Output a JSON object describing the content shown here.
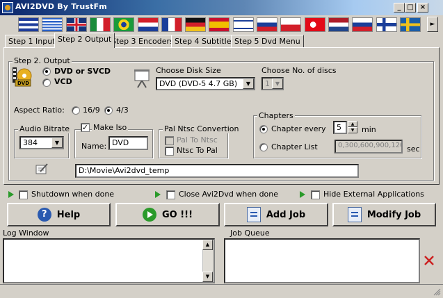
{
  "window": {
    "title": "AVI2DVD By TrustFm",
    "minimize_label": "_",
    "maximize_label": "□",
    "close_label": "×"
  },
  "flags": [
    "cuba",
    "greece",
    "uk",
    "italy",
    "brazil",
    "croatia",
    "france",
    "germany",
    "spain",
    "israel",
    "russia",
    "poland",
    "turkey",
    "netherlands",
    "slovakia",
    "finland",
    "sweden"
  ],
  "flag_scroll_label": "►",
  "tabs": [
    "Step 1 Input",
    "Step 2 Output",
    "Step 3 Encoders",
    "Step 4 Subtitles",
    "Step 5 Dvd Menu"
  ],
  "active_tab": "Step 2 Output",
  "output": {
    "group_label": "Step 2. Output",
    "dvd_label": "DVD or SVCD",
    "vcd_label": "VCD",
    "selected": "DVD or SVCD",
    "disk_size_label": "Choose Disk Size",
    "disk_size_value": "DVD (DVD-5 4.7 GB)",
    "discs_label": "Choose No. of discs",
    "discs_value": "1"
  },
  "aspect": {
    "label": "Aspect Ratio:",
    "option_16_9": "16/9",
    "option_4_3": "4/3",
    "selected": "4/3"
  },
  "audio": {
    "label": "Audio Bitrate",
    "value": "384"
  },
  "iso": {
    "make_iso_label": "Make Iso",
    "make_iso_checked": true,
    "name_label": "Name:",
    "name_value": "DVD"
  },
  "pal": {
    "label": "Pal Ntsc Convertion",
    "pal_to_ntsc": "Pal To Ntsc",
    "ntsc_to_pal": "Ntsc To Pal"
  },
  "chapters": {
    "label": "Chapters",
    "every_label": "Chapter every",
    "every_value": "5",
    "min_label": "min",
    "list_label": "Chapter List",
    "list_value": "0,300,600,900,120",
    "sec_label": "sec",
    "selected": "Chapter every"
  },
  "temp_path": "D:\\Movie\\Avi2dvd_temp",
  "options": {
    "shutdown": "Shutdown when done",
    "close_app": "Close Avi2Dvd when done",
    "hide_external": "Hide External Applications"
  },
  "buttons": {
    "help": "Help",
    "go": "GO !!!",
    "add_job": "Add Job",
    "modify_job": "Modify Job"
  },
  "log_window_label": "Log Window",
  "job_queue_label": "Job Queue",
  "colors": {
    "title_bar_start": "#0a246a",
    "title_bar_end": "#c8d8e8",
    "face": "#d4d0c8",
    "go_green": "#2a9a2a",
    "delete_red": "#cc2222",
    "help_blue": "#2a5ab0"
  }
}
